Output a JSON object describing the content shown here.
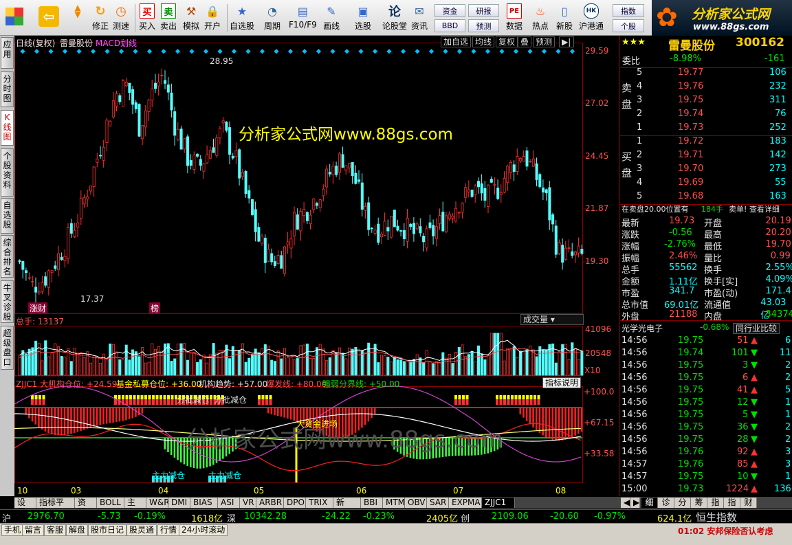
{
  "toolbar": {
    "buttons": [
      "修正",
      "测速",
      "买入",
      "卖出",
      "模拟",
      "开户",
      "自选股",
      "周期",
      "F10/F9",
      "画线",
      "选股",
      "论股堂",
      "资讯",
      "数据",
      "热点",
      "新股",
      "沪港通"
    ],
    "small": {
      "fund": "资金",
      "bbd": "BBD",
      "research": "研报",
      "forecast": "预测",
      "index": "指数",
      "personal": "个股"
    },
    "logo": "分析家公式网",
    "logo_url": "www.88gs.com"
  },
  "lefttabs": [
    "应用",
    "分时图",
    "K线图",
    "个股资料",
    "自选股",
    "综合排名",
    "牛叉诊股",
    "超级盘口"
  ],
  "chart": {
    "period": "日线(复权)",
    "stock": "雷曼股份",
    "indicator": "MACD划线",
    "buttons": [
      "加自选",
      "均线",
      "复权",
      "叠",
      "预测"
    ],
    "watermark": "分析家公式网www.88gs.com",
    "watermark2": "分析家公式网www.88gs.com",
    "high_label": "28.95",
    "low_label": "17.37",
    "tag1": "涨财",
    "tag2": "榜",
    "vol_title": "总手: 13137",
    "vol_btn": "成交量",
    "vol_mult": "X10",
    "ind_title": "ZJJC1 大机构仓位: +24.59",
    "ind_f1": "基金私募仓位: +36.00",
    "ind_f2": "机构趋势: +57.00",
    "ind_f3": "爆发线: +80.00",
    "ind_f4": "强弱分界线: +50.00",
    "ind_btn": "指标说明",
    "ann1": "分批减仓",
    "ann2": "分批减仓",
    "ann3": "大资金进场",
    "ann4": "主力减仓",
    "ann5": "主力减仓",
    "xlabels": [
      "10",
      "03",
      "04",
      "05",
      "06",
      "07",
      "08"
    ]
  },
  "chart_data": {
    "type": "line",
    "price_axis": [
      "29.59",
      "27.02",
      "24.45",
      "21.87",
      "19.30"
    ],
    "vol_axis": [
      "41096",
      "20548"
    ],
    "ind_axis": [
      "+100.0",
      "+67.15",
      "+33.58"
    ],
    "price_trend": [
      19.5,
      18.3,
      18.6,
      19.5,
      20.5,
      21.8,
      23.5,
      25.5,
      27.5,
      28.0,
      26.0,
      27.5,
      28.5,
      26.0,
      24.5,
      24.0,
      25.0,
      25.8,
      24.5,
      22.5,
      20.5,
      19.5,
      19.8,
      21.5,
      22.0,
      22.8,
      23.8,
      24.5,
      23.5,
      21.5,
      21.0,
      21.5,
      21.2,
      20.8,
      20.5,
      21.2,
      22.0,
      22.5,
      23.0,
      22.5,
      23.0,
      24.0,
      24.8,
      23.8,
      22.5,
      20.0,
      19.7,
      19.73
    ]
  },
  "bottom_tabs": [
    "设置",
    "指标平台",
    "资讯",
    "BOLL",
    "主力",
    "W&R",
    "DMI",
    "BIAS",
    "ASI",
    "VR",
    "ARBR",
    "DPO",
    "TRIX",
    "新DMA",
    "BBI",
    "MTM",
    "OBV",
    "SAR",
    "EXPMA",
    "ZJJC1"
  ],
  "right": {
    "name": "雷曼股份",
    "code": "300162",
    "weibi_l": "委比",
    "weibi": "-8.98%",
    "weicha": "-161",
    "sell_label": "卖盘",
    "buy_label": "买盘",
    "asks": [
      [
        "5",
        "19.77",
        "106"
      ],
      [
        "4",
        "19.76",
        "232"
      ],
      [
        "3",
        "19.75",
        "311"
      ],
      [
        "2",
        "19.74",
        "76"
      ],
      [
        "1",
        "19.73",
        "252"
      ]
    ],
    "bids": [
      [
        "1",
        "19.72",
        "183"
      ],
      [
        "2",
        "19.71",
        "142"
      ],
      [
        "3",
        "19.70",
        "273"
      ],
      [
        "4",
        "19.69",
        "55"
      ],
      [
        "5",
        "19.68",
        "163"
      ]
    ],
    "zaimai": "在卖盘20.00位置有",
    "zaimai_n": "184手",
    "zaimai_t": "卖单! 查看详细",
    "stats": [
      [
        "最新",
        "19.73",
        "开盘",
        "20.19"
      ],
      [
        "涨跌",
        "-0.56",
        "最高",
        "20.20"
      ],
      [
        "涨幅",
        "-2.76%",
        "最低",
        "19.70"
      ],
      [
        "振幅",
        "2.46%",
        "量比",
        "0.99"
      ],
      [
        "总手",
        "55562",
        "换手",
        "2.55%"
      ],
      [
        "金额",
        "1.11亿",
        "换手[实]",
        "4.09%"
      ],
      [
        "市盈",
        "341.7",
        "市盈(动)",
        "171.4"
      ],
      [
        "总市值",
        "69.01亿",
        "流通值",
        "43.03亿"
      ],
      [
        "外盘",
        "21188",
        "内盘",
        "34374"
      ]
    ],
    "sector": "光学光电子",
    "sector_pct": "-0.68%",
    "sector_btn": "同行业比较",
    "ticks": [
      [
        "14:56",
        "19.75",
        "51",
        "6"
      ],
      [
        "14:56",
        "19.74",
        "101",
        "11"
      ],
      [
        "14:56",
        "19.75",
        "3",
        "2"
      ],
      [
        "14:56",
        "19.75",
        "6",
        "2"
      ],
      [
        "14:56",
        "19.75",
        "41",
        "5"
      ],
      [
        "14:56",
        "19.75",
        "12",
        "1"
      ],
      [
        "14:56",
        "19.75",
        "5",
        "1"
      ],
      [
        "14:56",
        "19.75",
        "36",
        "2"
      ],
      [
        "14:56",
        "19.75",
        "28",
        "2"
      ],
      [
        "14:56",
        "19.76",
        "92",
        "3"
      ],
      [
        "14:57",
        "19.76",
        "85",
        "3"
      ],
      [
        "14:57",
        "19.75",
        "10",
        "1"
      ],
      [
        "15:00",
        "19.73",
        "1224",
        "136"
      ]
    ],
    "tabs": [
      "细",
      "诊",
      "分",
      "筹",
      "指",
      "指",
      "财"
    ]
  },
  "indexbar": {
    "sh_l": "沪",
    "sh": "2976.70",
    "sh_c": "-5.73",
    "sh_p": "-0.19%",
    "sh_v": "1618亿",
    "sz_l": "深",
    "sz": "10342.28",
    "sz_c": "-24.22",
    "sz_p": "-0.23%",
    "sz_v": "2405亿",
    "cy_l": "创",
    "cy": "2109.06",
    "cy_c": "-20.60",
    "cy_p": "-0.97%",
    "cy_v": "624.1亿",
    "hs": "恒生指数"
  },
  "statusbar": {
    "items": [
      "手机",
      "留言",
      "客服",
      "解盘",
      "股市日记",
      "股灵通",
      "行情",
      "24小时滚动"
    ],
    "news": "01:02 安邦保险否认考虑"
  }
}
